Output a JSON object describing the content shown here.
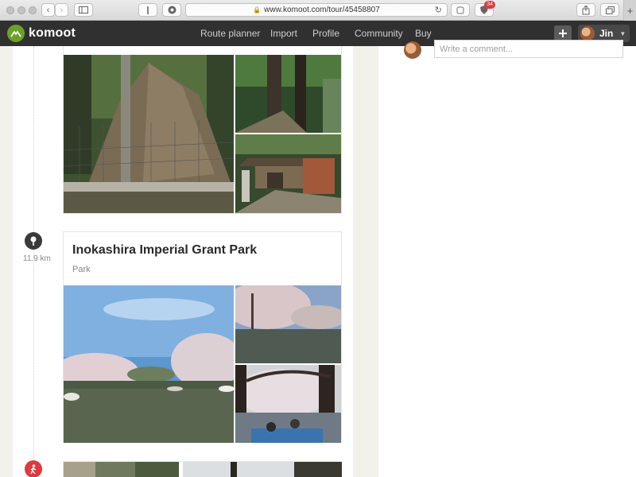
{
  "browser": {
    "url": "www.komoot.com/tour/45458807",
    "extension_badge": "34"
  },
  "header": {
    "brand": "komoot",
    "nav": [
      "Route planner",
      "Import",
      "Profile",
      "Community",
      "Buy"
    ],
    "user_name": "Jin"
  },
  "comment": {
    "placeholder": "Write a comment..."
  },
  "highlight": {
    "distance": "11.9 km",
    "title": "Inokashira Imperial Grant Park",
    "category": "Park"
  },
  "colors": {
    "brand_green": "#6aa127",
    "header_bg": "#303030",
    "waypoint_marker": "#3a3a3a",
    "hiking_marker": "#e0393e"
  },
  "icons": {
    "waypoint": "map-pin-icon",
    "next_step": "hiking-person-icon"
  }
}
